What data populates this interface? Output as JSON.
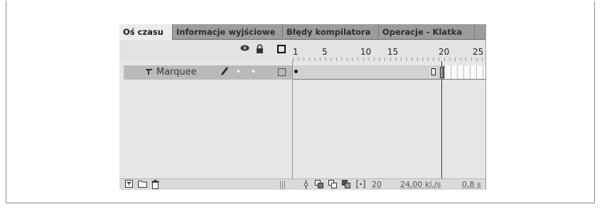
{
  "tabs": [
    {
      "label": "Oś czasu"
    },
    {
      "label": "Informacje wyjściowe"
    },
    {
      "label": "Błędy kompilatora"
    },
    {
      "label": "Operacje - Klatka"
    }
  ],
  "header": {
    "eye_icon": "eye-icon",
    "lock_icon": "lock-icon",
    "outline_icon": "outline-box-icon"
  },
  "ruler": {
    "numbers": [
      "1",
      "5",
      "10",
      "15",
      "20",
      "25"
    ]
  },
  "layer": {
    "name": "Marquee",
    "visible_dot": "•",
    "lock_dot": "•"
  },
  "playhead": {
    "frame": 20
  },
  "statusbar": {
    "current_frame": "20",
    "fps": "24,00 kl./s",
    "time": "0,8 s"
  },
  "colors": {
    "tab_bar": "#9c9c9c",
    "active_tab": "#ebebeb",
    "panel": "#e6e6e6",
    "layer_row": "#bababa"
  }
}
